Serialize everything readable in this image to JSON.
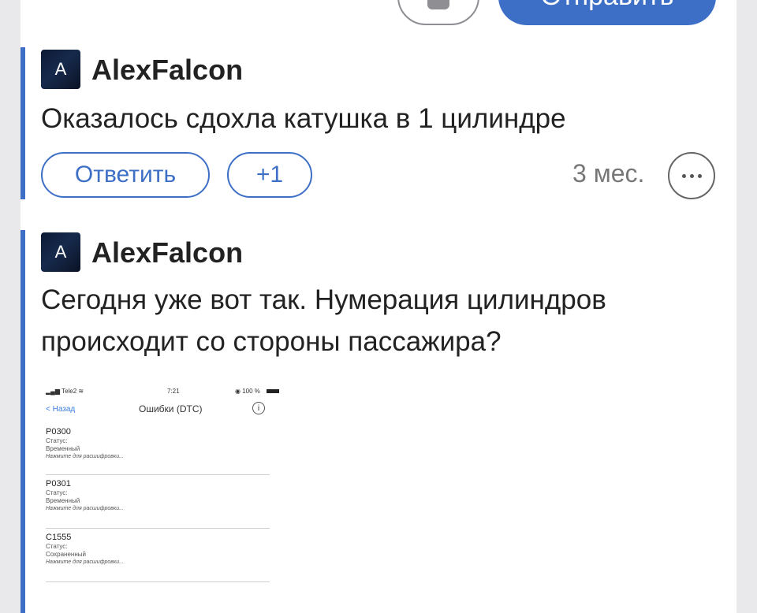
{
  "composer": {
    "attach_icon": "camera-icon",
    "send_label": "Отправить"
  },
  "comments": [
    {
      "avatar_letter": "A",
      "username": "AlexFalcon",
      "text": "Оказалось сдохла катушка в 1 цилиндре",
      "reply_label": "Ответить",
      "like_label": "+1",
      "time": "3 мес.",
      "more_icon": "more-dots-icon"
    },
    {
      "avatar_letter": "A",
      "username": "AlexFalcon",
      "text": "Сегодня уже вот так. Нумерация цилиндров происходит со стороны пассажира?",
      "attachment": {
        "carrier": "Tele2",
        "clock": "7:21",
        "battery": "100 %",
        "back_label": "< Назад",
        "title": "Ошибки (DTC)",
        "info_icon": "info-icon",
        "errors": [
          {
            "code": "P0300",
            "status_label": "Статус:",
            "status": "Временный",
            "hint": "Нажмите для расшифровки..."
          },
          {
            "code": "P0301",
            "status_label": "Статус:",
            "status": "Временный",
            "hint": "Нажмите для расшифровки..."
          },
          {
            "code": "C1555",
            "status_label": "Статус:",
            "status": "Сохраненный",
            "hint": "Нажмите для расшифровки..."
          }
        ]
      }
    }
  ],
  "colors": {
    "accent": "#3e6fc6",
    "muted": "#777777"
  }
}
